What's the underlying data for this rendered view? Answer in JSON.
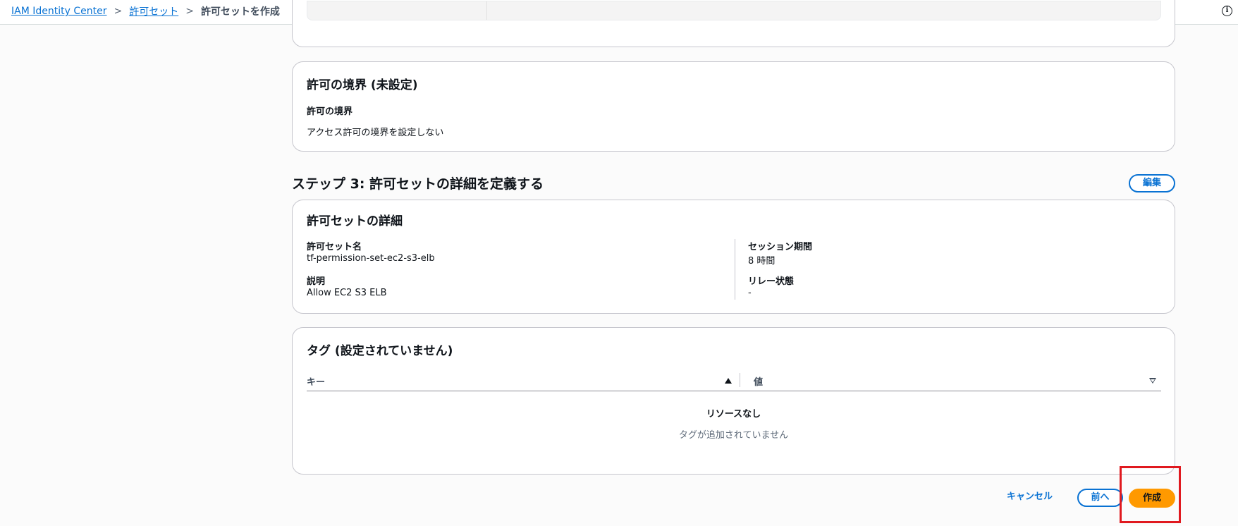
{
  "breadcrumb": {
    "items": [
      "IAM Identity Center",
      "許可セット"
    ],
    "current": "許可セットを作成",
    "separator": ">"
  },
  "info_icon": "info-icon",
  "boundary_card": {
    "title": "許可の境界 (未設定)",
    "label": "許可の境界",
    "value": "アクセス許可の境界を設定しない"
  },
  "step3": {
    "heading": "ステップ 3: 許可セットの詳細を定義する",
    "edit_label": "編集"
  },
  "details_card": {
    "title": "許可セットの詳細",
    "name_label": "許可セット名",
    "name_value": "tf-permission-set-ec2-s3-elb",
    "description_label": "説明",
    "description_value": "Allow EC2 S3 ELB",
    "session_label": "セッション期間",
    "session_value": "8 時間",
    "relay_label": "リレー状態",
    "relay_value": "-"
  },
  "tags_card": {
    "title": "タグ (設定されていません)",
    "columns": [
      "キー",
      "値"
    ],
    "empty_title": "リソースなし",
    "empty_subtitle": "タグが追加されていません"
  },
  "footer": {
    "cancel_label": "キャンセル",
    "prev_label": "前へ",
    "create_label": "作成"
  },
  "colors": {
    "link": "#0972d3",
    "primary_button": "#ff9900",
    "highlight": "#e0191f"
  }
}
